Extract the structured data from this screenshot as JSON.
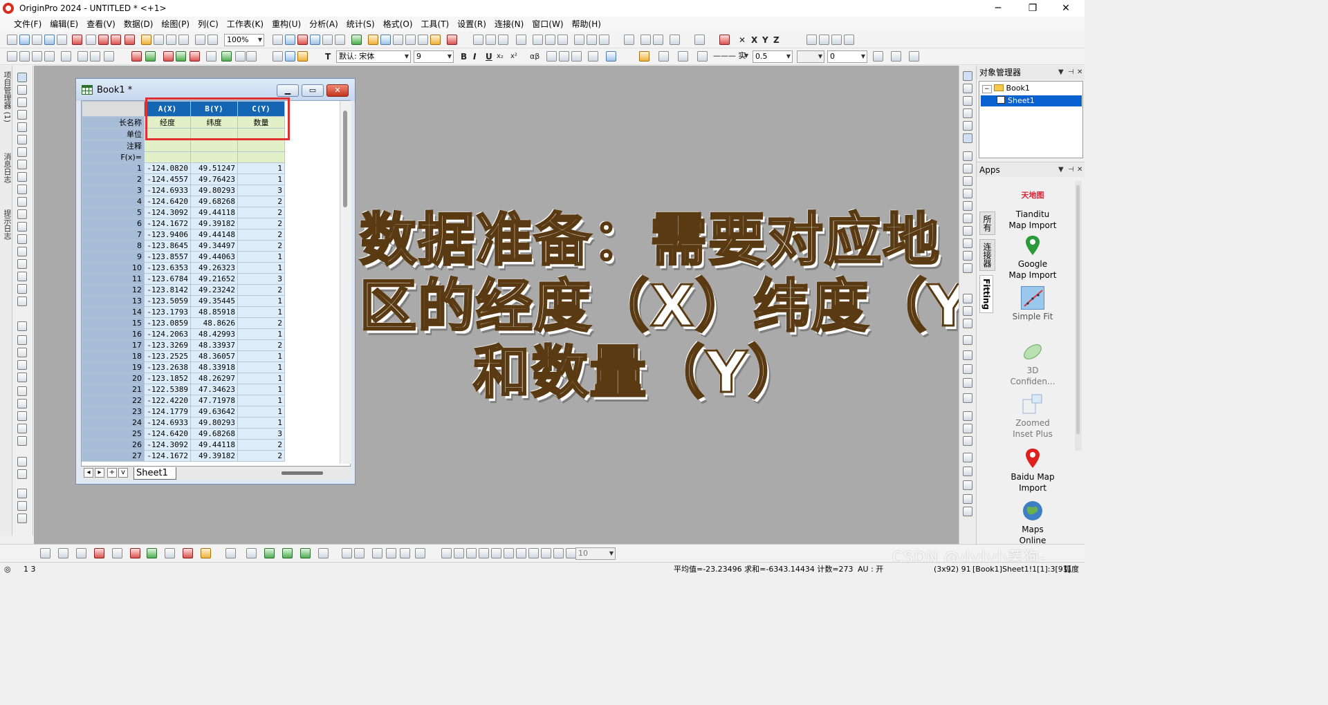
{
  "window": {
    "title": "OriginPro 2024 - UNTITLED * <+1>",
    "minimize": "─",
    "maximize": "❐",
    "close": "✕"
  },
  "menu": [
    "文件(F)",
    "编辑(E)",
    "查看(V)",
    "数据(D)",
    "绘图(P)",
    "列(C)",
    "工作表(K)",
    "重构(U)",
    "分析(A)",
    "统计(S)",
    "格式(O)",
    "工具(T)",
    "设置(R)",
    "连接(N)",
    "窗口(W)",
    "帮助(H)"
  ],
  "toolbar": {
    "zoom": "100%",
    "font_name": "默认: 宋体",
    "font_size": "9",
    "line_style": "——— 实",
    "line_width": "0.5",
    "number_box": "0",
    "bold": "B",
    "italic": "I",
    "underline": "U",
    "sub": "x₂",
    "sup": "x²",
    "greek": "αβ",
    "x_axis": "X",
    "y_axis": "Y",
    "z_axis": "Z",
    "text_tool": "T",
    "bottom_size": "10"
  },
  "left_panel": {
    "tab1": "项目管理器 (1)",
    "tab2": "消息日志",
    "tab3": "提示日志"
  },
  "book": {
    "title": "Book1 *",
    "sheet_tab": "Sheet1",
    "columns": [
      {
        "header": "A(X)",
        "long_name": "经度"
      },
      {
        "header": "B(Y)",
        "long_name": "纬度"
      },
      {
        "header": "C(Y)",
        "long_name": "数量"
      }
    ],
    "row_labels": {
      "long_name": "长名称",
      "units": "单位",
      "comments": "注释",
      "fx": "F(x)="
    },
    "rows": [
      [
        "1",
        "-124.0820",
        "49.51247",
        "1"
      ],
      [
        "2",
        "-124.4557",
        "49.76423",
        "1"
      ],
      [
        "3",
        "-124.6933",
        "49.80293",
        "3"
      ],
      [
        "4",
        "-124.6420",
        "49.68268",
        "2"
      ],
      [
        "5",
        "-124.3092",
        "49.44118",
        "2"
      ],
      [
        "6",
        "-124.1672",
        "49.39182",
        "2"
      ],
      [
        "7",
        "-123.9406",
        "49.44148",
        "2"
      ],
      [
        "8",
        "-123.8645",
        "49.34497",
        "2"
      ],
      [
        "9",
        "-123.8557",
        "49.44063",
        "1"
      ],
      [
        "10",
        "-123.6353",
        "49.26323",
        "1"
      ],
      [
        "11",
        "-123.6784",
        "49.21652",
        "3"
      ],
      [
        "12",
        "-123.8142",
        "49.23242",
        "2"
      ],
      [
        "13",
        "-123.5059",
        "49.35445",
        "1"
      ],
      [
        "14",
        "-123.1793",
        "48.85918",
        "1"
      ],
      [
        "15",
        "-123.0859",
        "48.8626",
        "2"
      ],
      [
        "16",
        "-124.2063",
        "48.42993",
        "1"
      ],
      [
        "17",
        "-123.3269",
        "48.33937",
        "2"
      ],
      [
        "18",
        "-123.2525",
        "48.36057",
        "1"
      ],
      [
        "19",
        "-123.2638",
        "48.33918",
        "1"
      ],
      [
        "20",
        "-123.1852",
        "48.26297",
        "1"
      ],
      [
        "21",
        "-122.5389",
        "47.34623",
        "1"
      ],
      [
        "22",
        "-122.4220",
        "47.71978",
        "1"
      ],
      [
        "23",
        "-124.1779",
        "49.63642",
        "1"
      ],
      [
        "24",
        "-124.6933",
        "49.80293",
        "1"
      ],
      [
        "25",
        "-124.6420",
        "49.68268",
        "3"
      ],
      [
        "26",
        "-124.3092",
        "49.44118",
        "2"
      ],
      [
        "27",
        "-124.1672",
        "49.39182",
        "2"
      ]
    ]
  },
  "overlay": {
    "line1": "数据准备：需要对应地",
    "line2": "区的经度（X）纬度（Y）",
    "line3": "和数量（Y）"
  },
  "object_manager": {
    "title": "对象管理器",
    "book": "Book1",
    "sheet": "Sheet1"
  },
  "apps": {
    "title": "Apps",
    "tabs": [
      "所有",
      "连接器",
      "Fitting"
    ],
    "items": [
      {
        "label": "Tianditu\nMap Import",
        "logo": "天地图"
      },
      {
        "label": "Google\nMap Import"
      },
      {
        "label": "Simple Fit"
      },
      {
        "label": "3D\nConfiden..."
      },
      {
        "label": "Zoomed\nInset Plus"
      },
      {
        "label": "Baidu Map\nImport"
      },
      {
        "label": "Maps\nOnline"
      }
    ]
  },
  "status": {
    "left": "1 3",
    "stats": "平均值=-23.23496 求和=-6343.14434 计数=273",
    "au": "AU : 开",
    "dims": "(3x92) 91",
    "sel": "[Book1]Sheet1!1[1]:3[91]",
    "unit": "弧度"
  },
  "watermark": "CSDN @小小小菜狗-",
  "colors": {
    "column_header": "#1565b5",
    "meta_row": "#e1f0c6",
    "data_cell": "#dcecf8",
    "row_header": "#a7bcd6",
    "highlight_box": "#e03030",
    "overlay_text": "#ffd57a"
  }
}
